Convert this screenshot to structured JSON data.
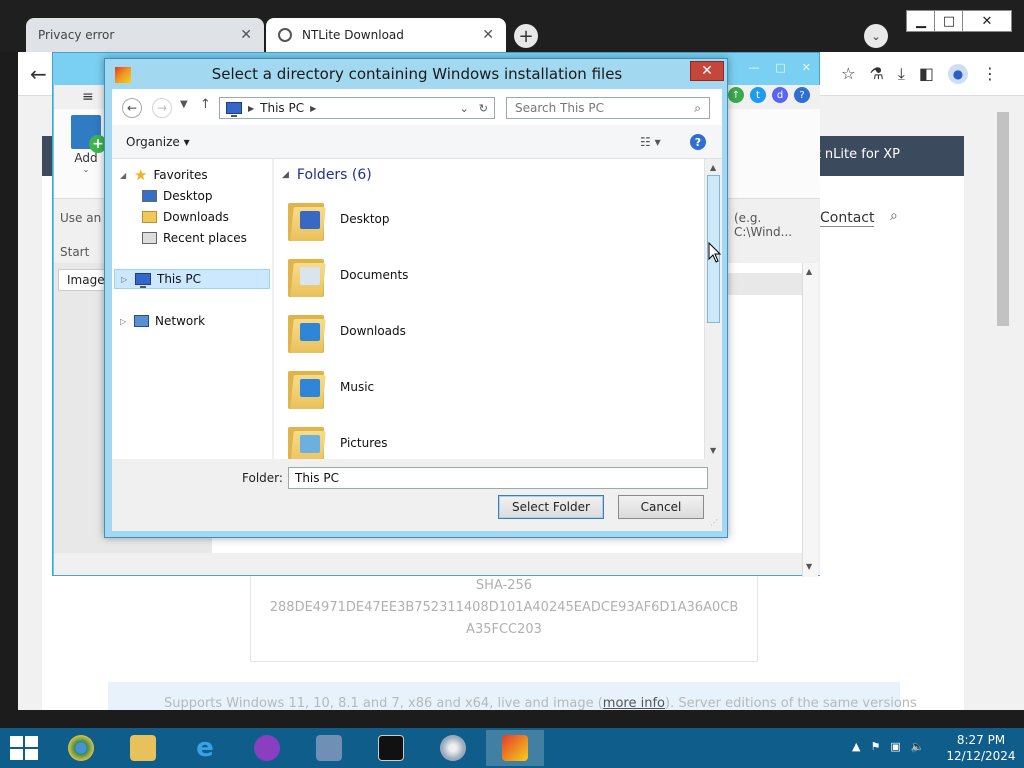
{
  "browser": {
    "tabs": [
      {
        "label": "Privacy error",
        "active": false
      },
      {
        "label": "NTLite Download",
        "active": true
      }
    ],
    "window_controls": {
      "minimize": "▁",
      "maximize": "□",
      "close": "✕"
    }
  },
  "website": {
    "nav_item": "Get nLite for XP",
    "contact": "Contact",
    "hash_label": "SHA-256",
    "hash_line1": "288DE4971DE47EE3B752311408D101A40245EADCE93AF6D1A36A0CB",
    "hash_line2": "A35FCC203",
    "support_text": "Supports Windows 11, 10, 8.1 and 7, x86 and x64, live and image (",
    "support_link": "more info",
    "support_tail": "). Server editions of the same versions"
  },
  "ntlite": {
    "add_label": "Add",
    "hint_left": "Use an e",
    "hint_right": "(e.g. C:\\Wind...",
    "start_col": "Start",
    "image_row": "Image"
  },
  "dialog": {
    "title": "Select a directory containing Windows installation files",
    "address": "This PC",
    "search_placeholder": "Search This PC",
    "organize": "Organize",
    "tree": [
      {
        "label": "Favorites",
        "icon": "star-icon"
      },
      {
        "label": "Desktop",
        "icon": "desktop-icon"
      },
      {
        "label": "Downloads",
        "icon": "downloads-icon"
      },
      {
        "label": "Recent places",
        "icon": "recent-places-icon"
      },
      {
        "label": "This PC",
        "icon": "pc-icon"
      },
      {
        "label": "Network",
        "icon": "network-icon"
      }
    ],
    "group_header": "Folders (6)",
    "folders": [
      {
        "label": "Desktop",
        "badge": "#3768c4"
      },
      {
        "label": "Documents",
        "badge": "#d9e4ef"
      },
      {
        "label": "Downloads",
        "badge": "#2d86d8"
      },
      {
        "label": "Music",
        "badge": "#2d86d8"
      },
      {
        "label": "Pictures",
        "badge": "#6cb0e0"
      }
    ],
    "folder_label": "Folder:",
    "folder_value": "This PC",
    "select_button": "Select Folder",
    "cancel_button": "Cancel"
  },
  "taskbar": {
    "time": "8:27 PM",
    "date": "12/12/2024"
  }
}
